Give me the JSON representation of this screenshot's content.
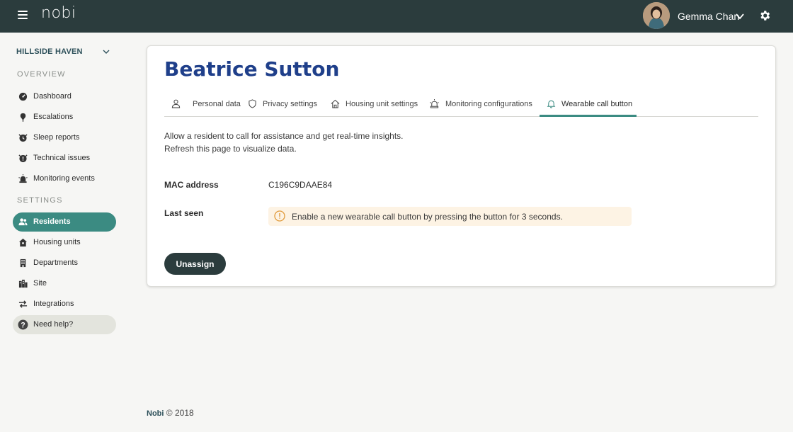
{
  "app": {
    "logo": "nobi"
  },
  "user": {
    "name": "Gemma Chan"
  },
  "sidebar": {
    "site": "HILLSIDE HAVEN",
    "overview_label": "OVERVIEW",
    "settings_label": "SETTINGS",
    "overview_items": [
      {
        "label": "Dashboard",
        "icon": "dashboard-icon"
      },
      {
        "label": "Escalations",
        "icon": "escalation-icon"
      },
      {
        "label": "Sleep reports",
        "icon": "sleep-report-icon"
      },
      {
        "label": "Technical issues",
        "icon": "technical-issue-icon"
      },
      {
        "label": "Monitoring events",
        "icon": "monitoring-event-icon"
      }
    ],
    "settings_items": [
      {
        "label": "Residents",
        "icon": "residents-icon",
        "active": true
      },
      {
        "label": "Housing units",
        "icon": "housing-unit-icon"
      },
      {
        "label": "Departments",
        "icon": "department-icon"
      },
      {
        "label": "Site",
        "icon": "site-icon"
      },
      {
        "label": "Integrations",
        "icon": "integration-icon"
      }
    ],
    "help": {
      "label": "Need help?",
      "icon": "help-icon"
    }
  },
  "resident": {
    "name": "Beatrice Sutton",
    "tabs": [
      {
        "label": "Personal data",
        "icon": "person-icon"
      },
      {
        "label": "Privacy settings",
        "icon": "shield-icon"
      },
      {
        "label": "Housing unit settings",
        "icon": "house-icon"
      },
      {
        "label": "Monitoring configurations",
        "icon": "alarm-light-icon"
      },
      {
        "label": "Wearable call button",
        "icon": "bell-icon",
        "active": true
      }
    ],
    "description_line1": "Allow a resident to call for assistance and get real-time insights.",
    "description_line2": "Refresh this page to visualize data.",
    "mac_label": "MAC address",
    "mac_value": "C196C9DAAE84",
    "last_seen_label": "Last seen",
    "alert_text": "Enable a new wearable call button by pressing the button for 3 seconds.",
    "unassign_label": "Unassign"
  },
  "footer": {
    "brand": "Nobi",
    "copyright": "© 2018"
  },
  "colors": {
    "topbar": "#2b3c3d",
    "accent": "#3b8b82",
    "title": "#1f3f8a",
    "alert_bg": "#fdf3e4",
    "alert_icon": "#e09a3a"
  }
}
